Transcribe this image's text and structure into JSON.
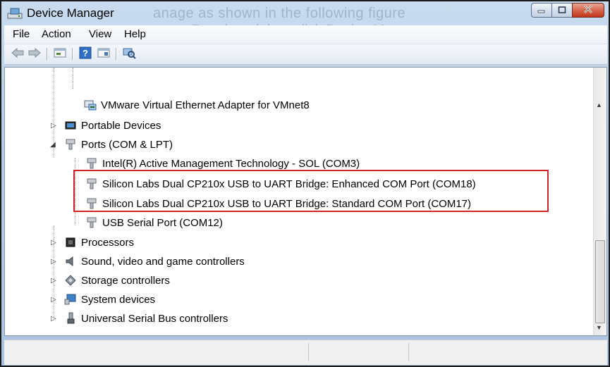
{
  "window": {
    "title": "Device Manager",
    "buttons": {
      "minimize": "minimize",
      "maximize": "maximize",
      "close": "close"
    }
  },
  "background_ghost": {
    "line1": "anage as shown in the following figure",
    "line2": "Panel, and then click Device Manager"
  },
  "menu": [
    "File",
    "Action",
    "View",
    "Help"
  ],
  "toolbar": [
    "back",
    "forward",
    "properties",
    "help",
    "view",
    "scan-hardware"
  ],
  "tree": {
    "items": [
      {
        "label": "VMware Virtual Ethernet Adapter for VMnet8",
        "level": 2,
        "icon": "network-adapter-icon"
      },
      {
        "label": "Portable Devices",
        "level": 1,
        "icon": "portable-device-icon",
        "expanded": false
      },
      {
        "label": "Ports (COM & LPT)",
        "level": 1,
        "icon": "port-icon",
        "expanded": true
      },
      {
        "label": "Intel(R) Active Management Technology - SOL (COM3)",
        "level": 2,
        "icon": "port-icon"
      },
      {
        "label": "Silicon Labs Dual CP210x USB to UART Bridge: Enhanced COM Port (COM18)",
        "level": 2,
        "icon": "port-icon"
      },
      {
        "label": "Silicon Labs Dual CP210x USB to UART Bridge: Standard COM Port (COM17)",
        "level": 2,
        "icon": "port-icon"
      },
      {
        "label": "USB Serial Port (COM12)",
        "level": 2,
        "icon": "port-icon"
      },
      {
        "label": "Processors",
        "level": 1,
        "icon": "processor-icon",
        "expanded": false
      },
      {
        "label": "Sound, video and game controllers",
        "level": 1,
        "icon": "speaker-icon",
        "expanded": false
      },
      {
        "label": "Storage controllers",
        "level": 1,
        "icon": "storage-icon",
        "expanded": false
      },
      {
        "label": "System devices",
        "level": 1,
        "icon": "system-device-icon",
        "expanded": false
      },
      {
        "label": "Universal Serial Bus controllers",
        "level": 1,
        "icon": "usb-icon",
        "expanded": false
      }
    ]
  },
  "highlight": {
    "color": "#d2232a"
  }
}
